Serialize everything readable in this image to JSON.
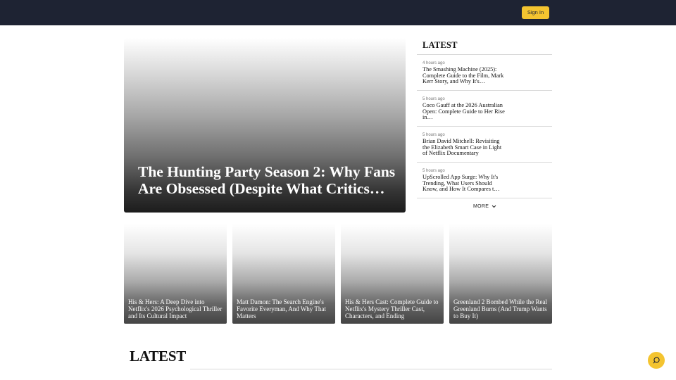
{
  "header": {
    "signin_label": "Sign In"
  },
  "hero": {
    "title": "The Hunting Party Season 2: Why Fans Are Obsessed (Despite What Critics…"
  },
  "sidebar": {
    "heading": "LATEST",
    "items": [
      {
        "time": "4 hours ago",
        "title": "The Smashing Machine (2025): Complete Guide to the Film, Mark Kerr Story, and Why It's…"
      },
      {
        "time": "5 hours ago",
        "title": "Coco Gauff at the 2026 Australian Open: Complete Guide to Her Rise in…"
      },
      {
        "time": "5 hours ago",
        "title": "Brian David Mitchell: Revisiting the Elizabeth Smart Case in Light of Netflix Documentary"
      },
      {
        "time": "5 hours ago",
        "title": "UpScrolled App Surge: Why It's Trending, What Users Should Know, and How It Compares t…"
      }
    ],
    "more_label": "MORE"
  },
  "cards": [
    {
      "title": "His & Hers: A Deep Dive into Netflix's 2026 Psychological Thriller and Its Cultural Impact"
    },
    {
      "title": "Matt Damon: The Search Engine's Favorite Everyman, And Why That Matters"
    },
    {
      "title": "His & Hers Cast: Complete Guide to Netflix's Mystery Thriller Cast, Characters, and Ending"
    },
    {
      "title": "Greenland 2 Bombed While the Real Greenland Burns (And Trump Wants to Buy It)"
    }
  ],
  "section": {
    "heading": "LATEST"
  },
  "icons": {
    "more": "chevron-down-icon",
    "fab": "chat-icon"
  },
  "colors": {
    "header_bg": "#1e2333",
    "accent": "#f4c430"
  }
}
